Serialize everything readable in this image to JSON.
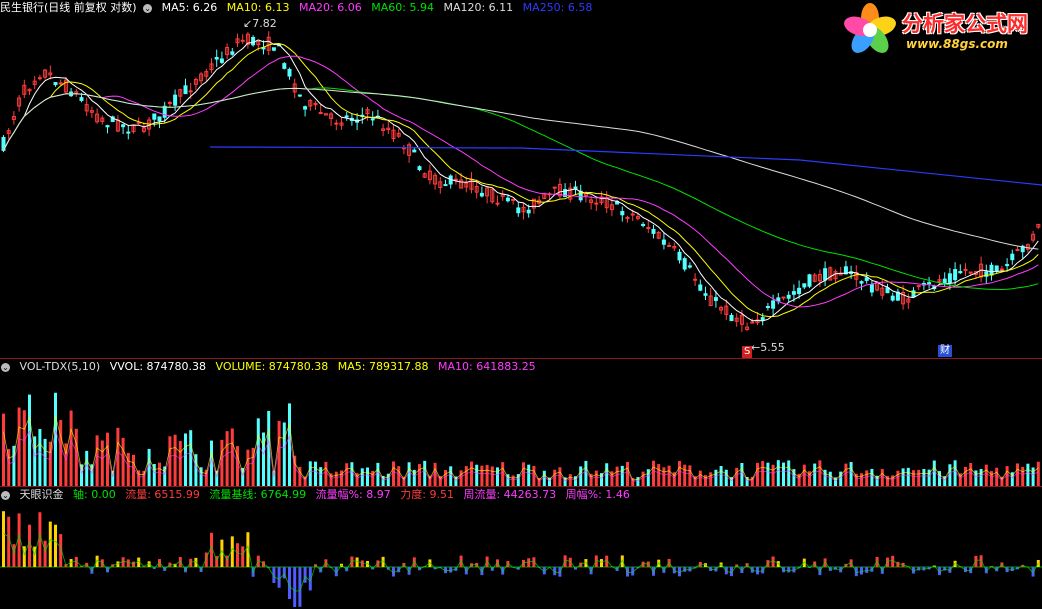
{
  "price": {
    "title": "民生银行(日线 前复权 对数)",
    "ma_items": [
      {
        "label": "MA5: 6.26",
        "color": "#ffffff"
      },
      {
        "label": "MA10: 6.13",
        "color": "#ffff00"
      },
      {
        "label": "MA20: 6.06",
        "color": "#ff3cff"
      },
      {
        "label": "MA60: 5.94",
        "color": "#00e000"
      },
      {
        "label": "MA120: 6.11",
        "color": "#dddddd"
      },
      {
        "label": "MA250: 6.58",
        "color": "#2b3cff"
      }
    ],
    "high_label": "7.82",
    "low_label": "5.55",
    "marker_s": "S",
    "marker_cai": "财"
  },
  "volume": {
    "title": "VOL-TDX(5,10)",
    "items": [
      {
        "label": "VVOL: 874780.38",
        "color": "#ffffff"
      },
      {
        "label": "VOLUME: 874780.38",
        "color": "#ffff00"
      },
      {
        "label": "MA5: 789317.88",
        "color": "#ffff00"
      },
      {
        "label": "MA10: 641883.25",
        "color": "#ff3cff"
      }
    ]
  },
  "flow": {
    "title": "天眼识金",
    "items": [
      {
        "label": "轴: 0.00",
        "color": "#00e000"
      },
      {
        "label": "流量: 6515.99",
        "color": "#ff3c3c"
      },
      {
        "label": "流量基线: 6764.99",
        "color": "#00e000"
      },
      {
        "label": "流量幅%: 8.97",
        "color": "#ff3cff"
      },
      {
        "label": "力度: 9.51",
        "color": "#ff3c3c"
      },
      {
        "label": "周流量: 44263.73",
        "color": "#ff3cff"
      },
      {
        "label": "周幅%: 1.46",
        "color": "#ff3cff"
      }
    ]
  },
  "logo": {
    "name": "分析家公式网",
    "url": "www.88gs.com"
  },
  "colors": {
    "up": "#ff3c3c",
    "down": "#54ffff",
    "flow_neg": "#4f5cff",
    "grid": "#8a1a1a"
  }
}
